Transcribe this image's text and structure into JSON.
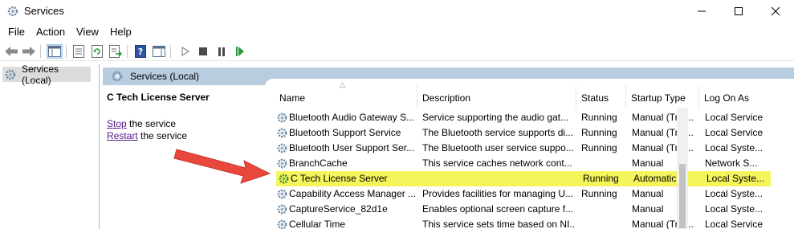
{
  "window": {
    "title": "Services"
  },
  "menu": [
    "File",
    "Action",
    "View",
    "Help"
  ],
  "tree": {
    "root_label": "Services (Local)"
  },
  "panel": {
    "header": "Services (Local)"
  },
  "detail": {
    "service_name": "C Tech License Server",
    "stop_link": "Stop",
    "stop_suffix": " the service",
    "restart_link": "Restart",
    "restart_suffix": " the service"
  },
  "columns": [
    "Name",
    "Description",
    "Status",
    "Startup Type",
    "Log On As"
  ],
  "rows": [
    {
      "name": "Bluetooth Audio Gateway S...",
      "description": "Service supporting the audio gat...",
      "status": "Running",
      "startup": "Manual (Trig...",
      "logon": "Local Service"
    },
    {
      "name": "Bluetooth Support Service",
      "description": "The Bluetooth service supports di...",
      "status": "Running",
      "startup": "Manual (Trig...",
      "logon": "Local Service"
    },
    {
      "name": "Bluetooth User Support Ser...",
      "description": "The Bluetooth user service suppo...",
      "status": "Running",
      "startup": "Manual (Trig...",
      "logon": "Local Syste..."
    },
    {
      "name": "BranchCache",
      "description": "This service caches network cont...",
      "status": "",
      "startup": "Manual",
      "logon": "Network S..."
    },
    {
      "name": "C Tech License Server",
      "description": "",
      "status": "Running",
      "startup": "Automatic",
      "logon": "Local Syste..."
    },
    {
      "name": "Capability Access Manager ...",
      "description": "Provides facilities for managing U...",
      "status": "Running",
      "startup": "Manual",
      "logon": "Local Syste..."
    },
    {
      "name": "CaptureService_82d1e",
      "description": "Enables optional screen capture f...",
      "status": "",
      "startup": "Manual",
      "logon": "Local Syste..."
    },
    {
      "name": "Cellular Time",
      "description": "This service sets time based on NI...",
      "status": "",
      "startup": "Manual (Trig...",
      "logon": "Local Service"
    }
  ],
  "colors": {
    "highlight": "#f4f45c",
    "arrow": "#e8473c",
    "header_band": "#b8cde0",
    "link": "#551a8b"
  }
}
